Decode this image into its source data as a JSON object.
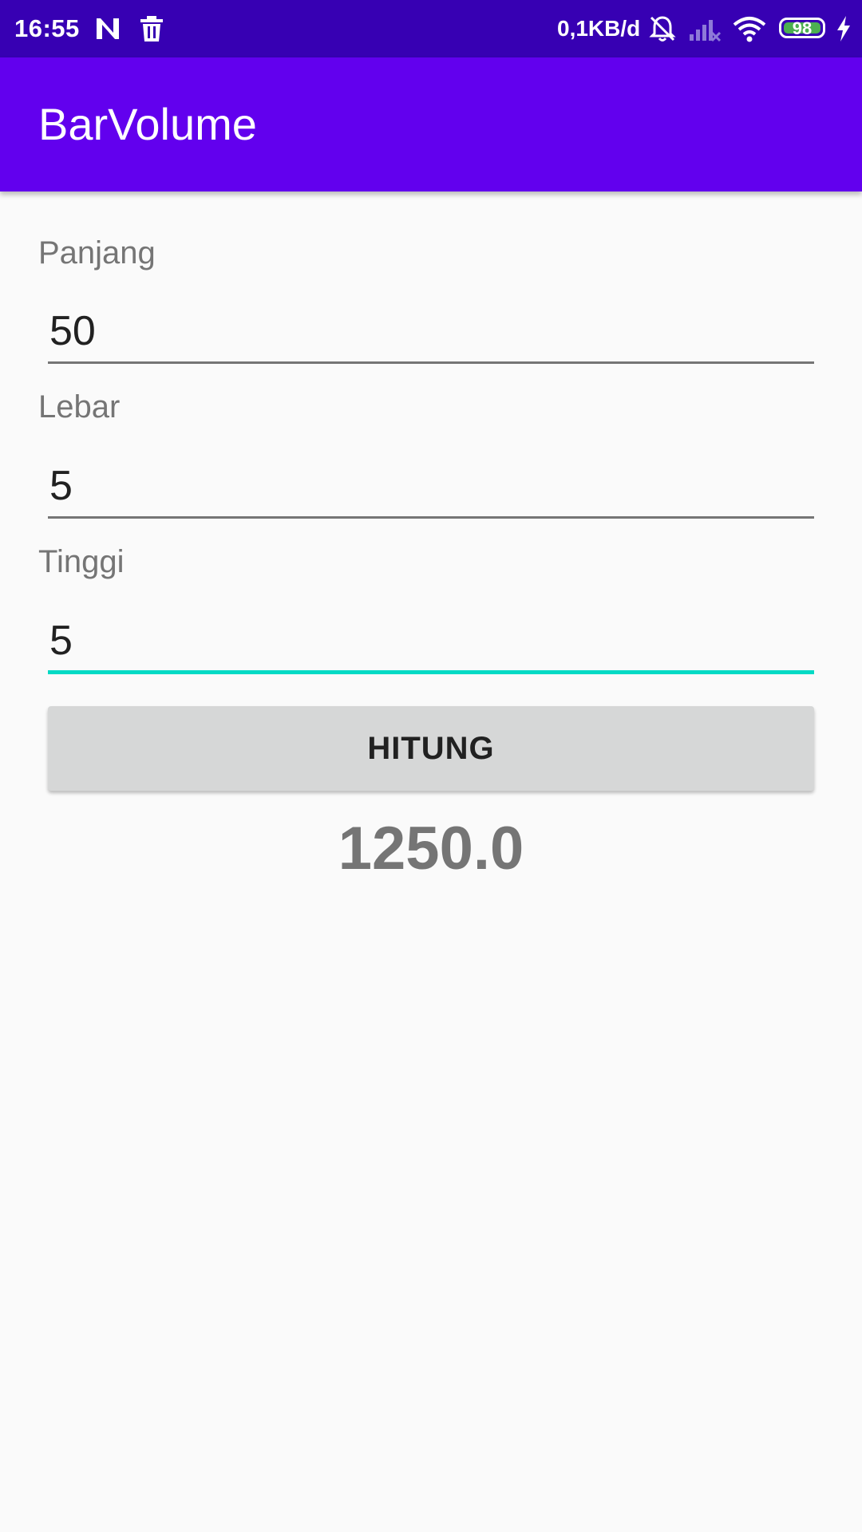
{
  "status_bar": {
    "time": "16:55",
    "network_speed": "0,1KB/d",
    "battery_level": "98",
    "icons": [
      "n-notification-icon",
      "trash-icon",
      "mute-bell-icon",
      "signal-no-service-icon",
      "wifi-icon",
      "battery-icon",
      "charging-bolt-icon"
    ],
    "background_color": "#3700b3"
  },
  "app_bar": {
    "title": "BarVolume",
    "background_color": "#6200ee"
  },
  "form": {
    "panjang": {
      "label": "Panjang",
      "value": "50"
    },
    "lebar": {
      "label": "Lebar",
      "value": "5"
    },
    "tinggi": {
      "label": "Tinggi",
      "value": "5"
    },
    "accent_color": "#03dac5"
  },
  "button": {
    "label": "HITUNG"
  },
  "result": {
    "value": "1250.0"
  }
}
